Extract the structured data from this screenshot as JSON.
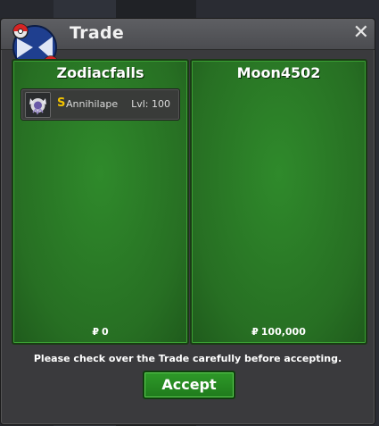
{
  "window": {
    "title": "Trade",
    "close_label": "✕"
  },
  "trade": {
    "left": {
      "player": "Zodiacfalls",
      "items": [
        {
          "shiny_mark": "S",
          "name": "Annihilape",
          "level": "Lvl: 100"
        }
      ],
      "currency_symbol": "₽",
      "money": "0"
    },
    "right": {
      "player": "Moon4502",
      "items": [],
      "currency_symbol": "₽",
      "money": "100,000"
    },
    "notice": "Please check over the Trade carefully before accepting.",
    "accept_label": "Accept"
  },
  "icons": {
    "logo": "pokeball-logo-icon",
    "pokemon": "annihilape-sprite-icon",
    "close": "close-icon"
  },
  "colors": {
    "panel_green": "#2f8a2b",
    "shiny_gold": "#f2c200",
    "button_green": "#2e9a29"
  }
}
